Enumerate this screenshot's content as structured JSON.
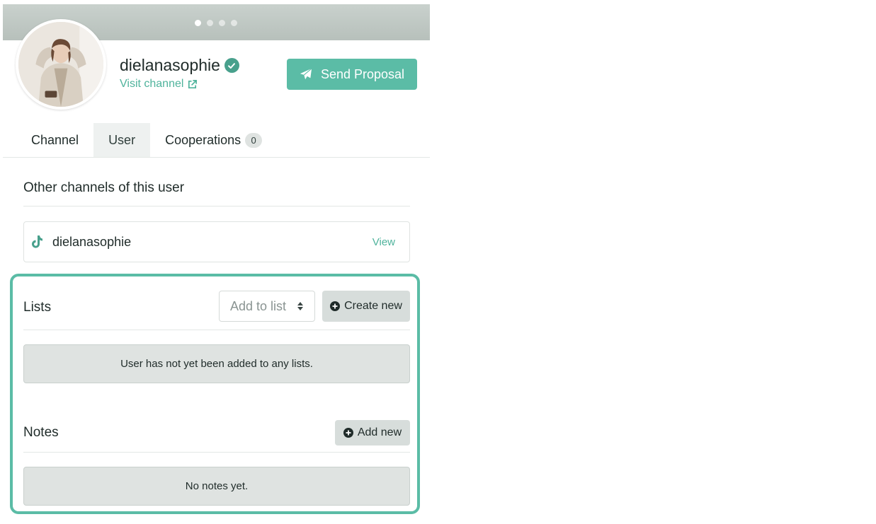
{
  "profile": {
    "username": "dielanasophie",
    "visit_channel_label": "Visit channel",
    "send_proposal_label": "Send Proposal"
  },
  "cover": {
    "dot_count": 4,
    "active_dot": 1
  },
  "tabs": [
    {
      "label": "Channel",
      "active": false
    },
    {
      "label": "User",
      "active": true
    },
    {
      "label": "Cooperations",
      "active": false,
      "count": "0"
    }
  ],
  "other_channels": {
    "title": "Other channels of this user",
    "items": [
      {
        "platform_icon": "tiktok-icon",
        "name": "dielanasophie",
        "action": "View"
      }
    ]
  },
  "lists": {
    "title": "Lists",
    "select_placeholder": "Add to list",
    "create_label": "Create new",
    "empty_text": "User has not yet been added to any lists."
  },
  "notes": {
    "title": "Notes",
    "add_label": "Add new",
    "empty_text": "No notes yet."
  },
  "colors": {
    "accent": "#5bbca6",
    "link": "#4fb39c",
    "verified": "#48a08c",
    "neutral_button": "#d7dddb"
  }
}
